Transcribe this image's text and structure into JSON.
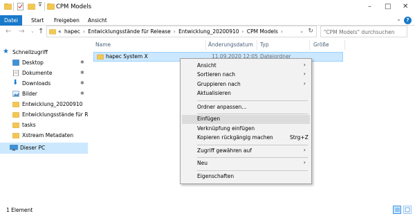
{
  "window": {
    "title": "CPM Models",
    "minimize_glyph": "–",
    "maximize_glyph": "□",
    "close_glyph": "✕"
  },
  "ribbon": {
    "tabs": [
      {
        "label": "Datei",
        "active": true
      },
      {
        "label": "Start",
        "active": false
      },
      {
        "label": "Freigeben",
        "active": false
      },
      {
        "label": "Ansicht",
        "active": false
      }
    ],
    "help": "?",
    "expand_glyph": "⌄"
  },
  "nav_buttons": {
    "back": "←",
    "forward": "→",
    "recent": "⌄",
    "up": "↑"
  },
  "address": {
    "prefix": "«",
    "crumbs": [
      "hapec",
      "Entwicklungsstände für Release",
      "Entwicklung_20200910",
      "CPM Models"
    ],
    "separator": "›",
    "dropdown": "⌄",
    "refresh": "↻"
  },
  "search": {
    "placeholder": "\"CPM Models\" durchsuchen"
  },
  "nav_pane": {
    "items": [
      {
        "label": "Schnellzugriff",
        "icon": "star-icon",
        "pinned": false
      },
      {
        "label": "Desktop",
        "icon": "desktop-icon",
        "pinned": true
      },
      {
        "label": "Dokumente",
        "icon": "documents-icon",
        "pinned": true
      },
      {
        "label": "Downloads",
        "icon": "downloads-icon",
        "pinned": true
      },
      {
        "label": "Bilder",
        "icon": "pictures-icon",
        "pinned": true
      },
      {
        "label": "Entwicklung_20200910",
        "icon": "folder-icon",
        "pinned": false
      },
      {
        "label": "Entwicklungsstände für Relea",
        "icon": "folder-icon",
        "pinned": false
      },
      {
        "label": "tasks",
        "icon": "folder-icon",
        "pinned": false
      },
      {
        "label": "Xstream Metadaten",
        "icon": "folder-icon",
        "pinned": false
      },
      {
        "label": "Dieser PC",
        "icon": "computer-icon",
        "pinned": false
      }
    ],
    "pin_glyph": "✱"
  },
  "columns": [
    "Name",
    "Änderungsdatum",
    "Typ",
    "Größe"
  ],
  "files": [
    {
      "name": "hapec System X",
      "date": "11.09.2020 12:05",
      "type": "Dateiordner",
      "size": ""
    }
  ],
  "context_menu": {
    "items": [
      {
        "label": "Ansicht",
        "arrow": "›",
        "shortcut": ""
      },
      {
        "label": "Sortieren nach",
        "arrow": "›",
        "shortcut": ""
      },
      {
        "label": "Gruppieren nach",
        "arrow": "›",
        "shortcut": ""
      },
      {
        "label": "Aktualisieren",
        "arrow": "",
        "shortcut": ""
      },
      {
        "label": "Ordner anpassen...",
        "arrow": "",
        "shortcut": ""
      },
      {
        "label": "Einfügen",
        "arrow": "",
        "shortcut": ""
      },
      {
        "label": "Verknüpfung einfügen",
        "arrow": "",
        "shortcut": ""
      },
      {
        "label": "Kopieren rückgängig machen",
        "arrow": "",
        "shortcut": "Strg+Z"
      },
      {
        "label": "Zugriff gewähren auf",
        "arrow": "›",
        "shortcut": ""
      },
      {
        "label": "Neu",
        "arrow": "›",
        "shortcut": ""
      },
      {
        "label": "Eigenschaften",
        "arrow": "",
        "shortcut": ""
      }
    ],
    "highlighted": "Einfügen"
  },
  "status": {
    "item_count": "1 Element"
  },
  "colors": {
    "accent": "#1979ca",
    "selection": "#cce8ff",
    "folder": "#f3c851",
    "menu_bg": "#f2f2f2"
  }
}
